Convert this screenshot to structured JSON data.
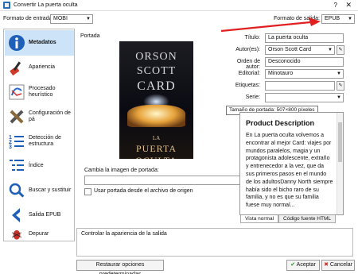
{
  "window": {
    "title": "Convertir La puerta oculta",
    "help": "?",
    "close": "✕"
  },
  "top": {
    "input_label": "Formato de entrada:",
    "input_value": "MOBI",
    "output_label": "Formato de salida:",
    "output_value": "EPUB"
  },
  "sidebar": {
    "items": [
      {
        "label": "Metadatos",
        "icon": "info-icon"
      },
      {
        "label": "Apariencia",
        "icon": "brush-icon"
      },
      {
        "label": "Procesado heurístico",
        "icon": "process-icon"
      },
      {
        "label": "Configuración de pá",
        "icon": "tools-icon"
      },
      {
        "label": "Detección de estructura",
        "icon": "list-numbers-icon"
      },
      {
        "label": "Índice",
        "icon": "toc-icon"
      },
      {
        "label": "Buscar y sustituir",
        "icon": "search-icon"
      },
      {
        "label": "Salida EPUB",
        "icon": "chevron-left-icon"
      },
      {
        "label": "Depurar",
        "icon": "bug-icon"
      }
    ]
  },
  "cover": {
    "section_label": "Portada",
    "line1": "ORSON",
    "line2": "SCOTT",
    "line3": "CARD",
    "subtitle_small": "LA",
    "subtitle_big": "PUERTA OCULTA",
    "change_label": "Cambia la imagen de portada:",
    "path_value": "",
    "use_file_label": "Usar portada desde el archivo de origen"
  },
  "form": {
    "title_label": "Título:",
    "title_value": "La puerta oculta",
    "author_label": "Autor(es):",
    "author_value": "Orson Scott Card",
    "author_sort_label": "Orden de autor:",
    "author_sort_value": "Desconocido",
    "publisher_label": "Editorial:",
    "publisher_value": "Minotauro",
    "tags_label": "Etiquetas:",
    "tags_value": "",
    "series_label": "Serie:",
    "series_value": ""
  },
  "tooltip": "Tamaño de portada: 507×800 píxeles",
  "description": {
    "heading": "Product Description",
    "body": "En La puerta oculta volvemos a encontrar al mejor Card: viajes por mundos paralelos, magia y un protagonista adolescente, extraño y entrenecedor a la vez, que da sus primeros pasos en el mundo de los adultosDanny North siempre había sido el bicho raro de su familia, y no es que su familia fuese muy normal...",
    "tab_view": "Vista normal",
    "tab_html": "Código fuente HTML"
  },
  "help_text": "Controlar la apariencia de la salida",
  "buttons": {
    "restore": "Restaurar opciones predeterminadas",
    "accept": "Aceptar",
    "cancel": "Cancelar"
  },
  "colors": {
    "selection": "#cde3f7",
    "annotation_arrow": "#e02020"
  }
}
